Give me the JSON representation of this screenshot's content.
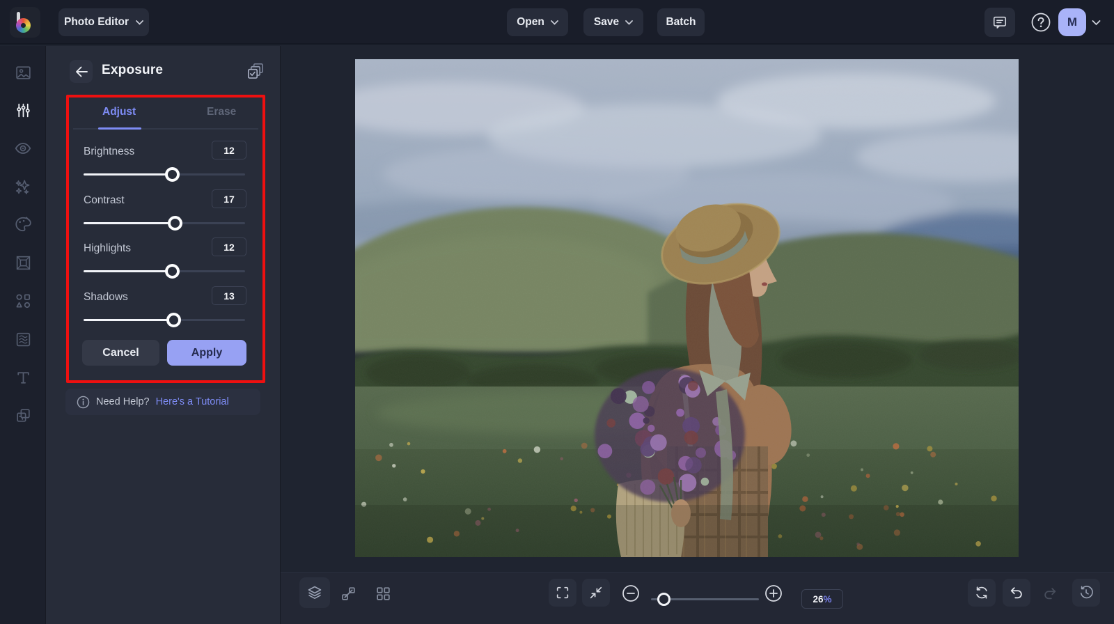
{
  "topbar": {
    "photo_editor_label": "Photo Editor",
    "open_label": "Open",
    "save_label": "Save",
    "batch_label": "Batch",
    "avatar_initial": "M"
  },
  "sidebar": {
    "items": [
      {
        "icon": "image-manager-icon",
        "active": false
      },
      {
        "icon": "edit-adjustments-icon",
        "active": true
      },
      {
        "icon": "touch-up-eye-icon",
        "active": false
      },
      {
        "icon": "effects-sparkles-icon",
        "active": false
      },
      {
        "icon": "artsy-palette-icon",
        "active": false
      },
      {
        "icon": "frames-icon",
        "active": false
      },
      {
        "icon": "graphics-shapes-icon",
        "active": false
      },
      {
        "icon": "textures-icon",
        "active": false
      },
      {
        "icon": "text-tool-icon",
        "active": false
      },
      {
        "icon": "overlays-icon",
        "active": false
      }
    ]
  },
  "panel": {
    "title": "Exposure",
    "header_icons": [
      "back-arrow-icon",
      "batch-apply-copies-icon"
    ],
    "tabs": [
      {
        "label": "Adjust",
        "active": true
      },
      {
        "label": "Erase",
        "active": false
      }
    ],
    "sliders": [
      {
        "label": "Brightness",
        "value": "12",
        "percent": 55
      },
      {
        "label": "Contrast",
        "value": "17",
        "percent": 57
      },
      {
        "label": "Highlights",
        "value": "12",
        "percent": 55
      },
      {
        "label": "Shadows",
        "value": "13",
        "percent": 56
      }
    ],
    "cancel_label": "Cancel",
    "apply_label": "Apply",
    "help_text": "Need Help?",
    "help_link_text": "Here's a Tutorial"
  },
  "bottombar": {
    "zoom_value": "26",
    "zoom_unit": "%",
    "zoom_slider_percent": 8,
    "icons": [
      "layers-icon",
      "resize-diagonal-icon",
      "grid-view-icon",
      "fullscreen-icon",
      "fit-to-screen-icon",
      "zoom-out-icon",
      "zoom-in-icon",
      "reset-icon",
      "undo-icon",
      "redo-icon",
      "history-icon"
    ],
    "redo_enabled": false
  },
  "annotation": {
    "red_highlight_box": true
  },
  "colors": {
    "accent": "#7e8cf5",
    "apply_button": "#97a1f3",
    "avatar_bg": "#a9b3f8",
    "red_box": "#ee1010",
    "panel_bg": "#272c39",
    "canvas_bg": "#1f2430",
    "topbar_bg": "#191d29"
  }
}
